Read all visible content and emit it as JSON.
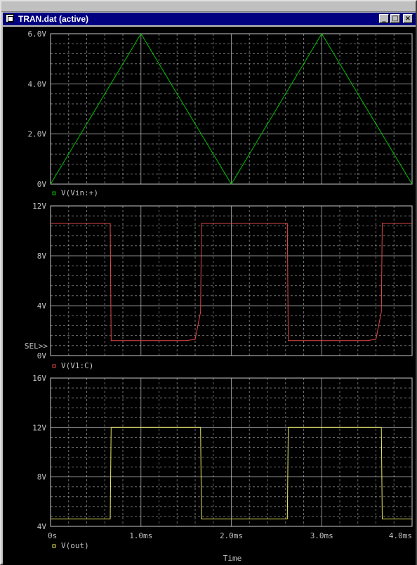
{
  "window": {
    "title": "TRAN.dat (active)",
    "minimize_label": "_",
    "maximize_label": "□",
    "close_label": "×"
  },
  "colors": {
    "background": "#000000",
    "grid": "#c8c8c8",
    "v1": "#00c000",
    "v2": "#e04848",
    "v3": "#e8e860",
    "title_bar": "#000080"
  },
  "chart_data": {
    "type": "line",
    "xlabel": "Time",
    "x_tick_labels": [
      "0s",
      "1.0ms",
      "2.0ms",
      "3.0ms",
      "4.0ms"
    ],
    "xlim": [
      0,
      4.0
    ],
    "x_unit": "ms",
    "plots": [
      {
        "y_tick_labels": [
          "0V",
          "2.0V",
          "4.0V",
          "6.0V"
        ],
        "ylim": [
          0,
          6
        ],
        "grid": true,
        "series": [
          {
            "name": "V(Vin:+)",
            "x": [
              0,
              1.0,
              2.0,
              3.0,
              4.0
            ],
            "y": [
              0,
              6,
              0,
              6,
              0
            ]
          }
        ]
      },
      {
        "y_tick_labels": [
          "0V",
          "4V",
          "8V",
          "12V"
        ],
        "ylim": [
          0,
          12
        ],
        "grid": true,
        "sel_marker": "SEL>>",
        "series": [
          {
            "name": "V(V1:C)",
            "x": [
              0,
              0.66,
              0.67,
              1.5,
              1.6,
              1.66,
              1.67,
              2.62,
              2.63,
              3.5,
              3.6,
              3.66,
              3.67,
              4.0
            ],
            "y": [
              10.6,
              10.6,
              1.2,
              1.2,
              1.3,
              3.5,
              10.6,
              10.6,
              1.2,
              1.2,
              1.3,
              3.5,
              10.6,
              10.6
            ]
          }
        ]
      },
      {
        "y_tick_labels": [
          "4V",
          "8V",
          "12V",
          "16V"
        ],
        "ylim": [
          4,
          16
        ],
        "grid": true,
        "series": [
          {
            "name": "V(out)",
            "x": [
              0,
              0.66,
              0.67,
              1.66,
              1.67,
              2.62,
              2.63,
              3.66,
              3.67,
              4.0
            ],
            "y": [
              4.6,
              4.6,
              12,
              12,
              4.6,
              4.6,
              12,
              12,
              4.6,
              4.6
            ]
          }
        ]
      }
    ]
  }
}
